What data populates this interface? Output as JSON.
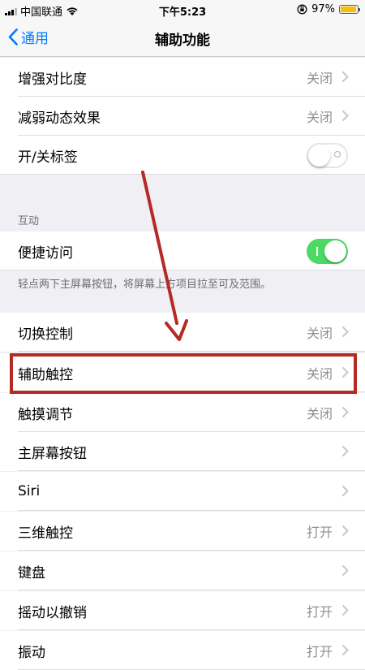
{
  "status_bar": {
    "carrier": "中国联通",
    "time": "下午5:23",
    "battery_percent": "97%",
    "battery_level": 0.97
  },
  "nav": {
    "back_label": "通用",
    "title": "辅助功能"
  },
  "rows": [
    {
      "label": "增强对比度",
      "value": "关闭"
    },
    {
      "label": "减弱动态效果",
      "value": "关闭"
    },
    {
      "label": "开/关标签",
      "toggle": "off"
    },
    {
      "label": "便捷访问",
      "toggle": "on"
    },
    {
      "label": "切换控制",
      "value": "关闭"
    },
    {
      "label": "辅助触控",
      "value": "关闭"
    },
    {
      "label": "触摸调节",
      "value": "关闭"
    },
    {
      "label": "主屏幕按钮",
      "value": ""
    },
    {
      "label": "Siri",
      "value": ""
    },
    {
      "label": "三维触控",
      "value": "打开"
    },
    {
      "label": "键盘",
      "value": ""
    },
    {
      "label": "摇动以撤销",
      "value": "打开"
    },
    {
      "label": "振动",
      "value": "打开"
    }
  ],
  "sections": {
    "interaction_header": "互动",
    "reachability_footer": "轻点两下主屏幕按钮，将屏幕上方项目拉至可及范围。"
  },
  "colors": {
    "accent": "#007aff",
    "toggle_on": "#4cd964",
    "annotation_red": "#b52a25",
    "battery": "#f5c000"
  },
  "icons": {
    "back": "chevron-left-icon",
    "disclosure": "chevron-right-icon",
    "wifi": "wifi-icon",
    "orientation_lock": "orientation-lock-icon",
    "battery": "battery-icon",
    "signal": "signal-bars-icon"
  }
}
